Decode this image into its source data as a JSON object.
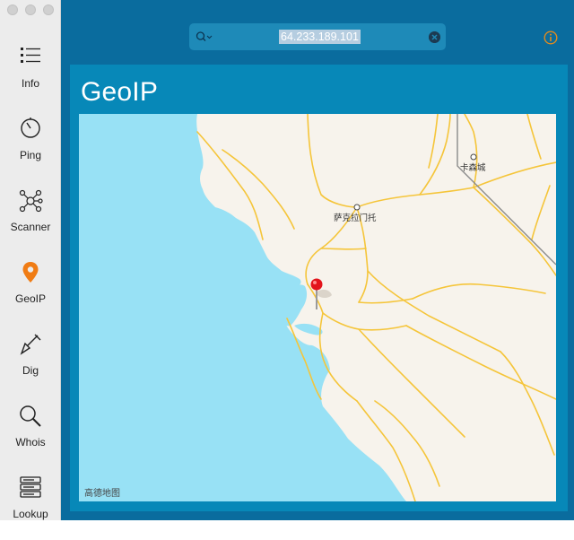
{
  "sidebar": {
    "items": [
      {
        "label": "Info",
        "icon": "list-icon"
      },
      {
        "label": "Ping",
        "icon": "stopwatch-icon"
      },
      {
        "label": "Scanner",
        "icon": "network-icon"
      },
      {
        "label": "GeoIP",
        "icon": "location-pin-icon",
        "selected": true
      },
      {
        "label": "Dig",
        "icon": "shovel-icon"
      },
      {
        "label": "Whois",
        "icon": "magnifier-icon"
      },
      {
        "label": "Lookup",
        "icon": "server-stack-icon"
      }
    ]
  },
  "search": {
    "value": "64.233.189.101"
  },
  "page": {
    "title": "GeoIP"
  },
  "map": {
    "cities": [
      "萨克拉门托",
      "卡森城"
    ],
    "attribution": "高德地图",
    "colors": {
      "water": "#98e1f5",
      "land": "#f7f3ec",
      "roads": "#f5c53a",
      "pin": "#e3141b"
    }
  }
}
